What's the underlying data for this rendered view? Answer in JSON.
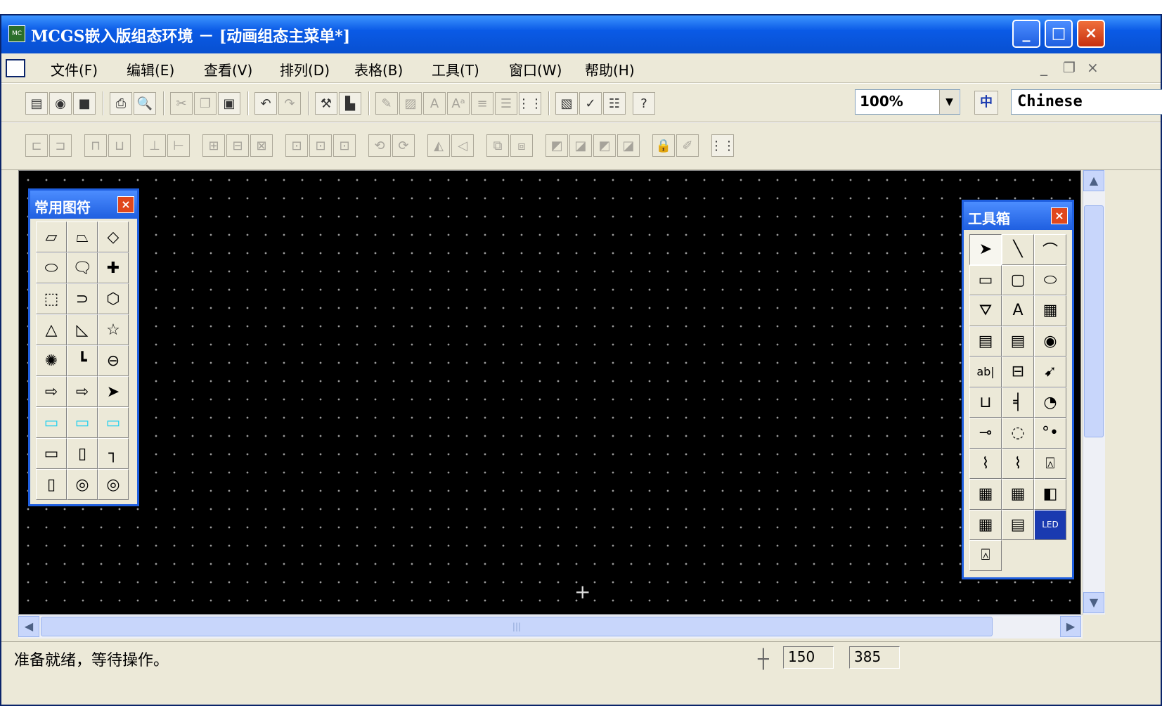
{
  "window": {
    "title": "MCGS嵌入版组态环境 － [动画组态主菜单*]",
    "controls": {
      "minimize": "_",
      "maximize": "□",
      "close": "×"
    }
  },
  "menu": {
    "items": [
      "文件(F)",
      "编辑(E)",
      "查看(V)",
      "排列(D)",
      "表格(B)",
      "工具(T)",
      "窗口(W)",
      "帮助(H)"
    ],
    "mdi_controls": {
      "minimize": "_",
      "restore": "❐",
      "close": "×"
    }
  },
  "toolbar1": {
    "zoom": "100%",
    "language": "Chinese",
    "lang_icon": "中"
  },
  "symbols_panel": {
    "title": "常用图符",
    "close": "×",
    "symbols": [
      "▱",
      "⏢",
      "◇",
      "⬭",
      "🗨",
      "✚",
      "⬚",
      "⊃",
      "⬡",
      "△",
      "◺",
      "☆",
      "✺",
      "┗",
      "⊖",
      "⇨",
      "⇨",
      "➤",
      "▭",
      "▭",
      "▭",
      "▭",
      "▯",
      "┐",
      "▯",
      "◎",
      "◎"
    ]
  },
  "toolbox": {
    "title": "工具箱",
    "close": "×",
    "tools": [
      "➤",
      "╲",
      "⌒",
      "▭",
      "▢",
      "⬭",
      "⛛",
      "A",
      "▦",
      "▤",
      "▤",
      "◉",
      "ab|",
      "⊟",
      "➹",
      "⊔",
      "╡",
      "◔",
      "⊸",
      "◌",
      "°•",
      "⌇",
      "⌇",
      "⍓",
      "▦",
      "▦",
      "◧",
      "▦",
      "▤",
      "LED",
      "⍓"
    ]
  },
  "status": {
    "text": "准备就绪，等待操作。",
    "x": "150",
    "y": "385"
  },
  "colors": {
    "title": "#1f5fe0",
    "canvas": "#000000",
    "accent_cyan": "#20d0f0"
  }
}
